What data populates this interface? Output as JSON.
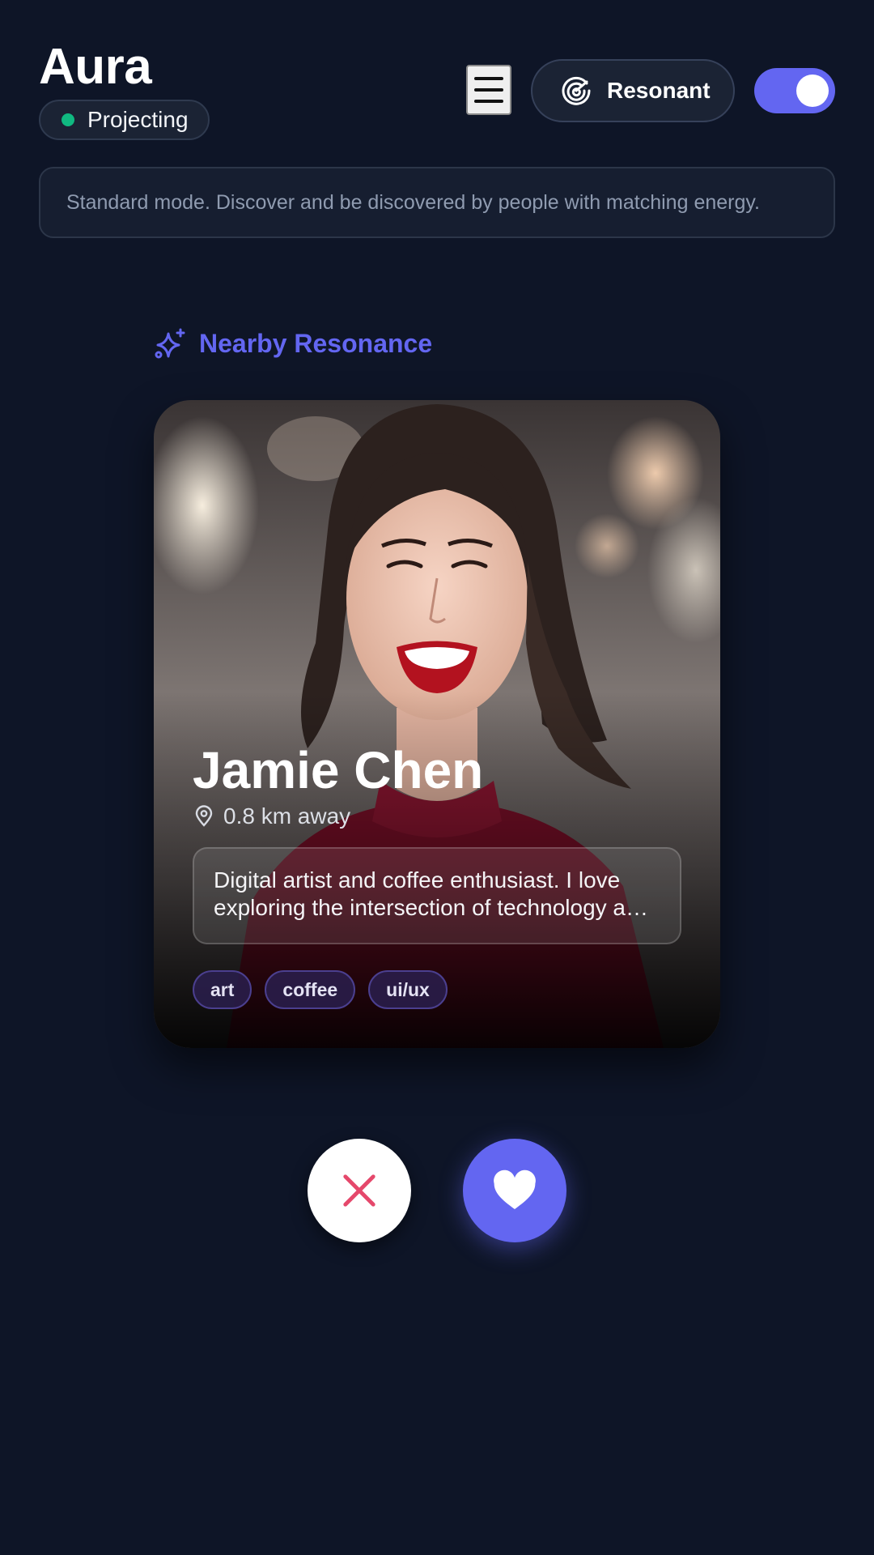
{
  "header": {
    "app_title": "Aura",
    "status_label": "Projecting",
    "status_color": "#10b981",
    "mode_label": "Resonant",
    "toggle_on": true,
    "accent_color": "#6366f1"
  },
  "banner": {
    "text": "Standard mode. Discover and be discovered by people with matching energy."
  },
  "section": {
    "title": "Nearby Resonance",
    "icon": "sparkles-icon"
  },
  "profile": {
    "name": "Jamie Chen",
    "distance": "0.8 km away",
    "bio": "Digital artist and coffee enthusiast. I love exploring the intersection of technology and creativity.",
    "tags": [
      "art",
      "coffee",
      "ui/ux"
    ]
  },
  "actions": {
    "pass_icon": "close-icon",
    "pass_color": "#e5486b",
    "like_icon": "heart-icon"
  }
}
